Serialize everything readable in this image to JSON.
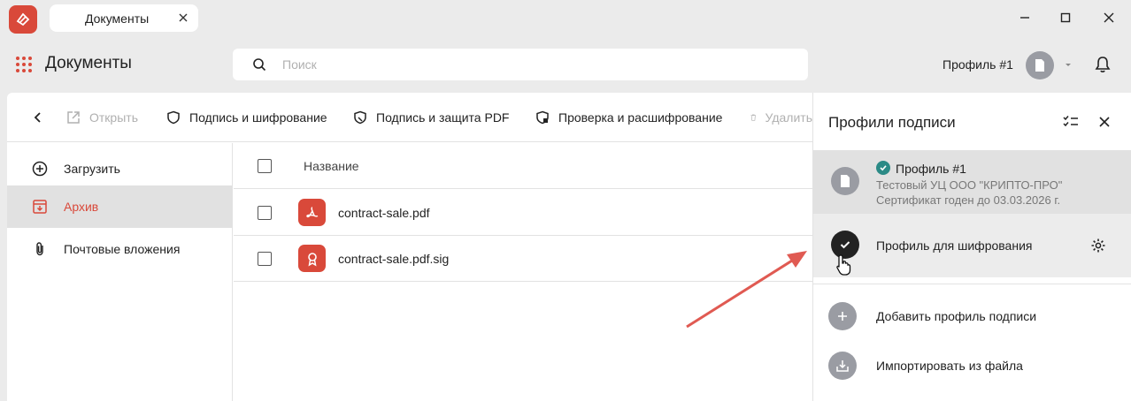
{
  "window": {
    "tab_label": "Документы",
    "controls": [
      "minimize-icon",
      "maximize-icon",
      "close-icon"
    ]
  },
  "header": {
    "title": "Документы",
    "search_placeholder": "Поиск",
    "profile_label": "Профиль #1"
  },
  "toolbar": {
    "open_label": "Открыть",
    "sign_encrypt_label": "Подпись и шифрование",
    "sign_pdf_label": "Подпись и защита PDF",
    "verify_decrypt_label": "Проверка и расшифрование",
    "delete_label": "Удалить"
  },
  "sidebar": {
    "items": [
      {
        "label": "Загрузить",
        "icon": "plus-circle-icon",
        "active": false
      },
      {
        "label": "Архив",
        "icon": "archive-icon",
        "active": true
      },
      {
        "label": "Почтовые вложения",
        "icon": "paperclip-icon",
        "active": false
      }
    ]
  },
  "files": {
    "column_name": "Название",
    "rows": [
      {
        "name": "contract-sale.pdf",
        "icon": "pdf-icon"
      },
      {
        "name": "contract-sale.pdf.sig",
        "icon": "signature-file-icon"
      }
    ]
  },
  "panel": {
    "title": "Профили подписи",
    "profiles": [
      {
        "name": "Профиль #1",
        "issuer": "Тестовый УЦ ООО \"КРИПТО-ПРО\"",
        "validity": "Сертификат годен до 03.03.2026 г.",
        "selected": true
      },
      {
        "name": "Профиль для шифрования"
      }
    ],
    "add_label": "Добавить профиль подписи",
    "import_label": "Импортировать из файла"
  },
  "colors": {
    "accent": "#d9493a",
    "badge": "#2b8a86",
    "arrow": "#e05a52"
  }
}
